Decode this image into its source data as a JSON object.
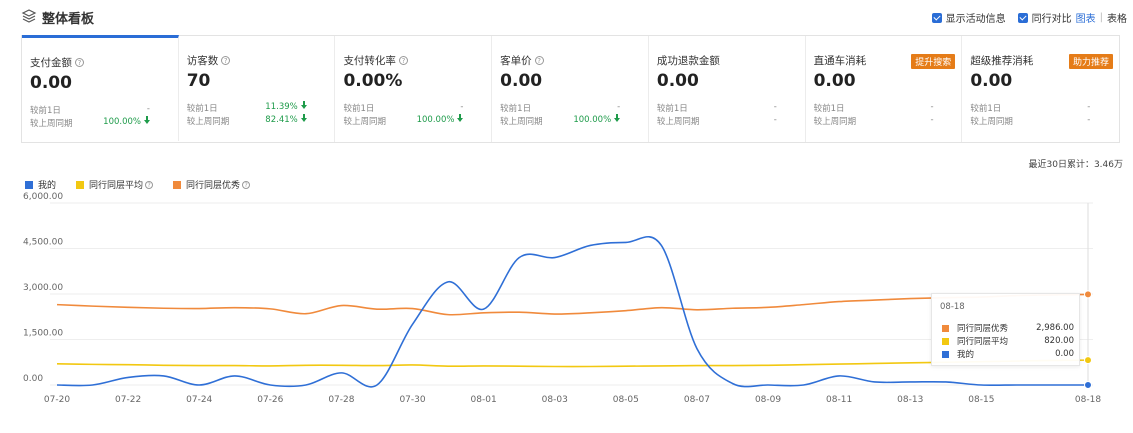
{
  "header": {
    "title": "整体看板",
    "show_activity_label": "显示活动信息",
    "peer_compare_label": "同行对比",
    "view_chart_label": "图表",
    "view_separator": "|",
    "view_table_label": "表格"
  },
  "cards": [
    {
      "name": "支付金额",
      "value": "0.00",
      "day_label": "较前1日",
      "day_value": "-",
      "week_label": "较上周同期",
      "week_value": "100.00%"
    },
    {
      "name": "访客数",
      "value": "70",
      "day_label": "较前1日",
      "day_value": "11.39%",
      "week_label": "较上周同期",
      "week_value": "82.41%"
    },
    {
      "name": "支付转化率",
      "value": "0.00%",
      "day_label": "较前1日",
      "day_value": "-",
      "week_label": "较上周同期",
      "week_value": "100.00%"
    },
    {
      "name": "客单价",
      "value": "0.00",
      "day_label": "较前1日",
      "day_value": "-",
      "week_label": "较上周同期",
      "week_value": "100.00%"
    },
    {
      "name": "成功退款金额",
      "value": "0.00",
      "day_label": "较前1日",
      "day_value": "-",
      "week_label": "较上周同期",
      "week_value": "-"
    },
    {
      "name": "直通车消耗",
      "value": "0.00",
      "tag": "提升搜索",
      "day_label": "较前1日",
      "day_value": "-",
      "week_label": "较上周同期",
      "week_value": "-"
    },
    {
      "name": "超级推荐消耗",
      "value": "0.00",
      "tag": "助力推荐",
      "day_label": "较前1日",
      "day_value": "-",
      "week_label": "较上周同期",
      "week_value": "-"
    }
  ],
  "cumulative_text": "最近30日累计：3.46万",
  "colors": {
    "mine": "#2f6fd6",
    "avg": "#f2c811",
    "excellent": "#f08a3c",
    "accent": "#2a6dd6",
    "up_green": "#1e9b4a",
    "tag_orange": "#e57c18"
  },
  "tooltip": {
    "date": "08-18",
    "rows": [
      {
        "name": "同行同层优秀",
        "value": "2,986.00"
      },
      {
        "name": "同行同层平均",
        "value": "820.00"
      },
      {
        "name": "我的",
        "value": "0.00"
      }
    ]
  },
  "chart_data": {
    "type": "line",
    "x": [
      "07-20",
      "07-21",
      "07-22",
      "07-23",
      "07-24",
      "07-25",
      "07-26",
      "07-27",
      "07-28",
      "07-29",
      "07-30",
      "07-31",
      "08-01",
      "08-02",
      "08-03",
      "08-04",
      "08-05",
      "08-06",
      "08-07",
      "08-08",
      "08-09",
      "08-10",
      "08-11",
      "08-12",
      "08-13",
      "08-14",
      "08-15",
      "08-16",
      "08-17",
      "08-18"
    ],
    "x_tick_labels": [
      "07-20",
      "07-22",
      "07-24",
      "07-26",
      "07-28",
      "07-30",
      "08-01",
      "08-03",
      "08-05",
      "08-07",
      "08-09",
      "08-11",
      "08-13",
      "08-15",
      "08-18"
    ],
    "ylim": [
      0,
      6000
    ],
    "y_ticks": [
      0,
      1500,
      3000,
      4500,
      6000
    ],
    "y_tick_labels": [
      "0.00",
      "1,500.00",
      "3,000.00",
      "4,500.00",
      "6,000.00"
    ],
    "series": [
      {
        "name": "我的",
        "values": [
          0,
          0,
          250,
          300,
          0,
          300,
          0,
          0,
          400,
          0,
          2000,
          3400,
          2500,
          4200,
          4200,
          4600,
          4700,
          4600,
          1200,
          50,
          0,
          0,
          300,
          100,
          100,
          100,
          0,
          0,
          0,
          0
        ]
      },
      {
        "name": "同行同层平均",
        "values": [
          700,
          680,
          670,
          650,
          640,
          640,
          630,
          650,
          650,
          640,
          660,
          620,
          630,
          620,
          610,
          610,
          620,
          630,
          640,
          640,
          650,
          670,
          690,
          710,
          730,
          750,
          770,
          790,
          810,
          820
        ]
      },
      {
        "name": "同行同层优秀",
        "values": [
          2650,
          2600,
          2560,
          2530,
          2520,
          2550,
          2510,
          2350,
          2620,
          2500,
          2520,
          2320,
          2380,
          2400,
          2340,
          2380,
          2450,
          2550,
          2480,
          2530,
          2560,
          2650,
          2750,
          2800,
          2850,
          2880,
          2900,
          2950,
          2970,
          2986
        ]
      }
    ],
    "grid": true,
    "legend_position": "top-left"
  }
}
